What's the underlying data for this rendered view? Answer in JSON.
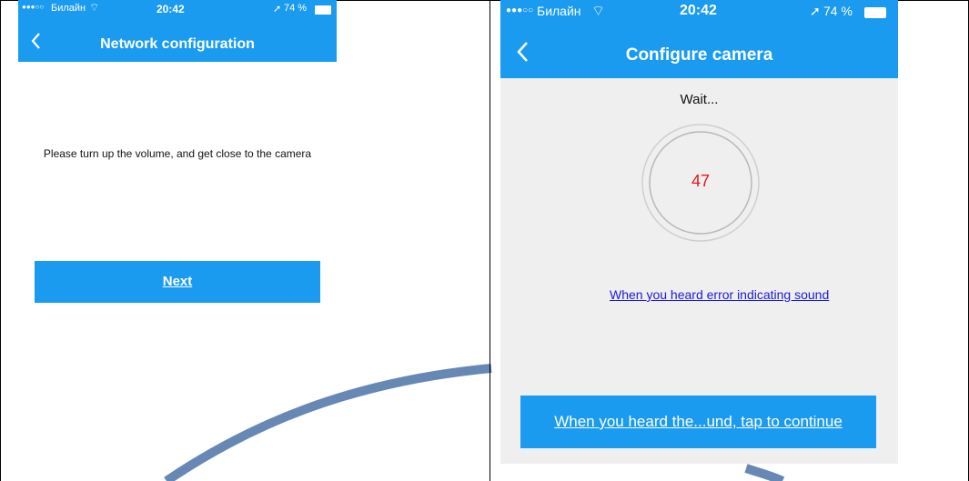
{
  "left_screen": {
    "status": {
      "signal": "●●●○○",
      "carrier": "Билайн",
      "time": "20:42",
      "battery": "74 %"
    },
    "nav": {
      "back_icon": "chevron-left-icon",
      "title": "Network configuration"
    },
    "instruction": "Please turn up the volume, and get close to the camera",
    "next_label": "Next"
  },
  "right_screen": {
    "status": {
      "signal": "●●●○○",
      "carrier": "Билайн",
      "time": "20:42",
      "battery": "74 %"
    },
    "nav": {
      "back_icon": "chevron-left-icon",
      "title": "Configure camera"
    },
    "wait_text": "Wait...",
    "countdown": "47",
    "error_link": "When you heard error indicating sound",
    "continue_label": "When you heard the...und, tap to continue"
  },
  "colors": {
    "accent": "#1a9bf0",
    "countdown": "#e8141b",
    "link": "#1a1adf",
    "arc": "#6787b5"
  }
}
